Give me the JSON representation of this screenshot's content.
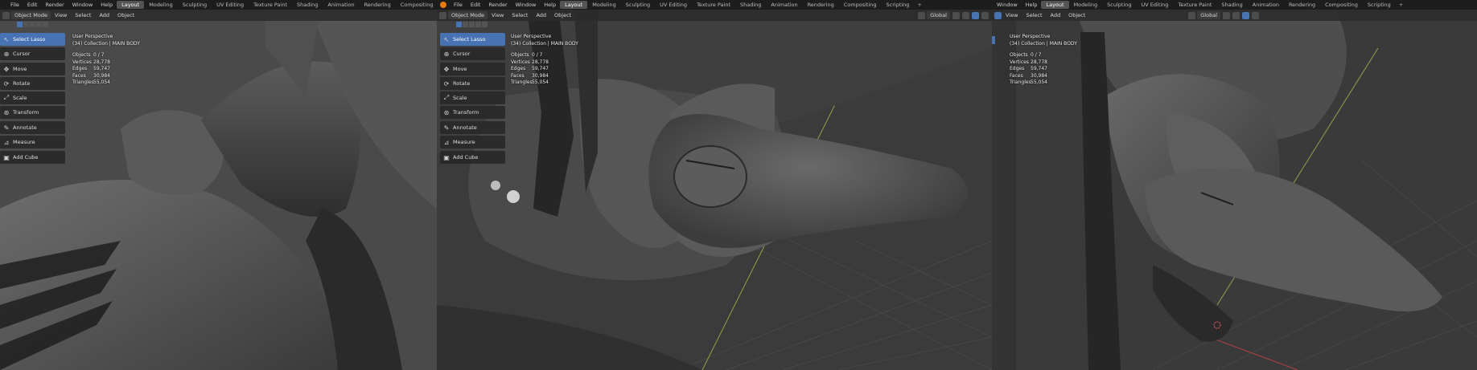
{
  "topbar": {
    "menus": [
      "File",
      "Edit",
      "Render",
      "Window",
      "Help"
    ],
    "workspaces": [
      "Layout",
      "Modeling",
      "Sculpting",
      "UV Editing",
      "Texture Paint",
      "Shading",
      "Animation",
      "Rendering",
      "Compositing",
      "Scripting"
    ],
    "active_workspace": "Layout",
    "plus": "+",
    "p3_menus": [
      "Window",
      "Help"
    ]
  },
  "header": {
    "mode": "Object Mode",
    "menus": [
      "View",
      "Select",
      "Add",
      "Object"
    ],
    "orientation": "Global"
  },
  "toolbar": {
    "tools": [
      {
        "label": "Select Lasso",
        "icon": "lasso-select-icon",
        "glyph": "↖"
      },
      {
        "label": "Cursor",
        "icon": "cursor-icon",
        "glyph": "⊕"
      },
      {
        "label": "Move",
        "icon": "move-icon",
        "glyph": "✥"
      },
      {
        "label": "Rotate",
        "icon": "rotate-icon",
        "glyph": "⟳"
      },
      {
        "label": "Scale",
        "icon": "scale-icon",
        "glyph": "⤢"
      },
      {
        "label": "Transform",
        "icon": "transform-icon",
        "glyph": "⊛"
      },
      {
        "label": "Annotate",
        "icon": "annotate-icon",
        "glyph": "✎"
      },
      {
        "label": "Measure",
        "icon": "measure-icon",
        "glyph": "📐"
      },
      {
        "label": "Add Cube",
        "icon": "add-cube-icon",
        "glyph": "▣"
      }
    ]
  },
  "viewport_info": {
    "perspective": "User Perspective",
    "collection": "(34) Collection | MAIN BODY",
    "stats": [
      {
        "label": "Objects",
        "value": "0 / 7"
      },
      {
        "label": "Vertices",
        "value": "28,778"
      },
      {
        "label": "Edges",
        "value": "59,747"
      },
      {
        "label": "Faces",
        "value": "30,984"
      },
      {
        "label": "Triangles",
        "value": "55,054"
      }
    ]
  },
  "colors": {
    "accent": "#4772b3",
    "blender_orange": "#e87d0d",
    "topbar_bg": "#1d1d1d",
    "viewport_bg": "#3d3d3d"
  }
}
